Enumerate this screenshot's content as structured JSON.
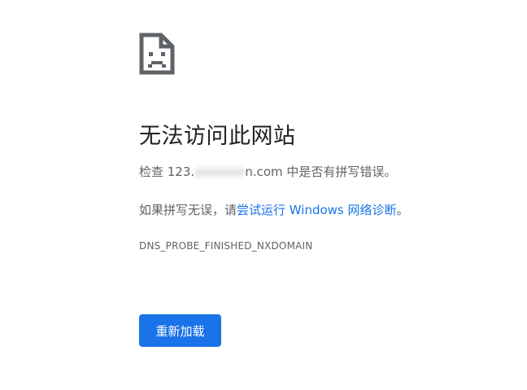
{
  "error": {
    "icon": "sad-document-icon",
    "title": "无法访问此网站",
    "check_prefix": "检查 123.",
    "check_blurred": "xxxxxxx",
    "check_domain": "n.com",
    "check_suffix": " 中是否有拼写错误。",
    "suggest_prefix": "如果拼写无误，请",
    "suggest_link": "尝试运行 Windows 网络诊断",
    "suggest_suffix": "。",
    "code": "DNS_PROBE_FINISHED_NXDOMAIN"
  },
  "actions": {
    "reload_label": "重新加载"
  },
  "colors": {
    "accent": "#1a73e8",
    "text": "#202124",
    "secondary": "#5f6368"
  }
}
